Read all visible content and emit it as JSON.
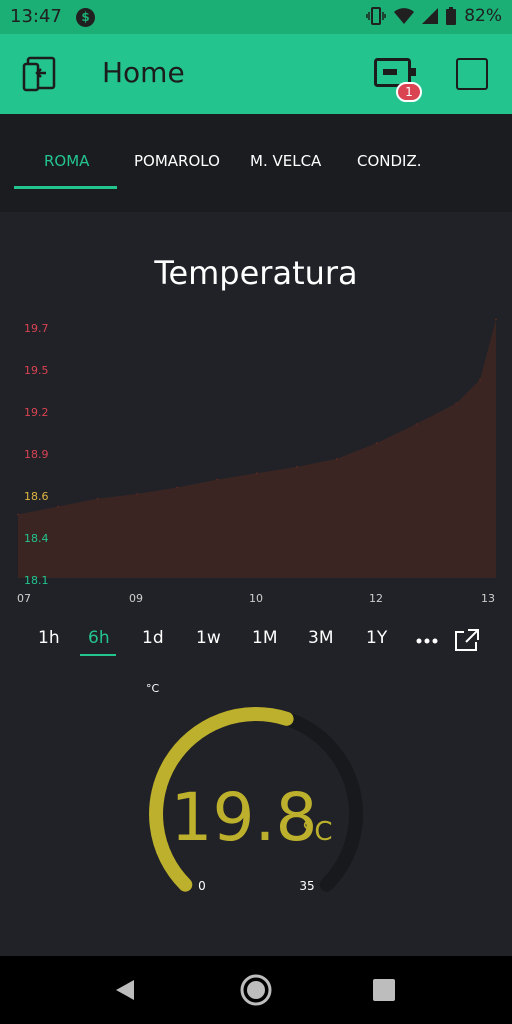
{
  "status": {
    "time": "13:47",
    "battery": "82%"
  },
  "header": {
    "title": "Home",
    "badge_count": "1"
  },
  "tabs": [
    {
      "label": "ROMA",
      "active": true
    },
    {
      "label": "POMAROLO",
      "active": false
    },
    {
      "label": "M. VELCA",
      "active": false
    },
    {
      "label": "CONDIZ.",
      "active": false
    }
  ],
  "chart_data": {
    "type": "area",
    "title": "Temperatura",
    "x_ticks": [
      "07",
      "09",
      "10",
      "12",
      "13"
    ],
    "y_ticks": [
      "19.7",
      "19.5",
      "19.2",
      "18.9",
      "18.6",
      "18.4",
      "18.1"
    ],
    "ylim": [
      18.1,
      19.7
    ],
    "x": [
      7.0,
      7.5,
      8.0,
      8.5,
      9.0,
      9.5,
      10.0,
      10.5,
      11.0,
      11.5,
      12.0,
      12.5,
      12.8,
      13.0
    ],
    "values": [
      18.5,
      18.55,
      18.6,
      18.63,
      18.67,
      18.72,
      18.76,
      18.8,
      18.85,
      18.95,
      19.07,
      19.2,
      19.35,
      19.73
    ],
    "series_color": "#6b2a1e",
    "tick_colors": [
      "#d94352",
      "#d94352",
      "#d94352",
      "#d94352",
      "#e0b642",
      "#23c48e",
      "#23c48e"
    ]
  },
  "time_ranges": [
    {
      "label": "1h",
      "active": false
    },
    {
      "label": "6h",
      "active": true
    },
    {
      "label": "1d",
      "active": false
    },
    {
      "label": "1w",
      "active": false
    },
    {
      "label": "1M",
      "active": false
    },
    {
      "label": "3M",
      "active": false
    },
    {
      "label": "1Y",
      "active": false
    }
  ],
  "gauge": {
    "unit_label": "°C",
    "value": "19.8",
    "unit": "°C",
    "min": "0",
    "max": "35",
    "fraction": 0.566,
    "color": "#bcb02c"
  },
  "colors": {
    "accent": "#23c48e",
    "background": "#212227"
  }
}
